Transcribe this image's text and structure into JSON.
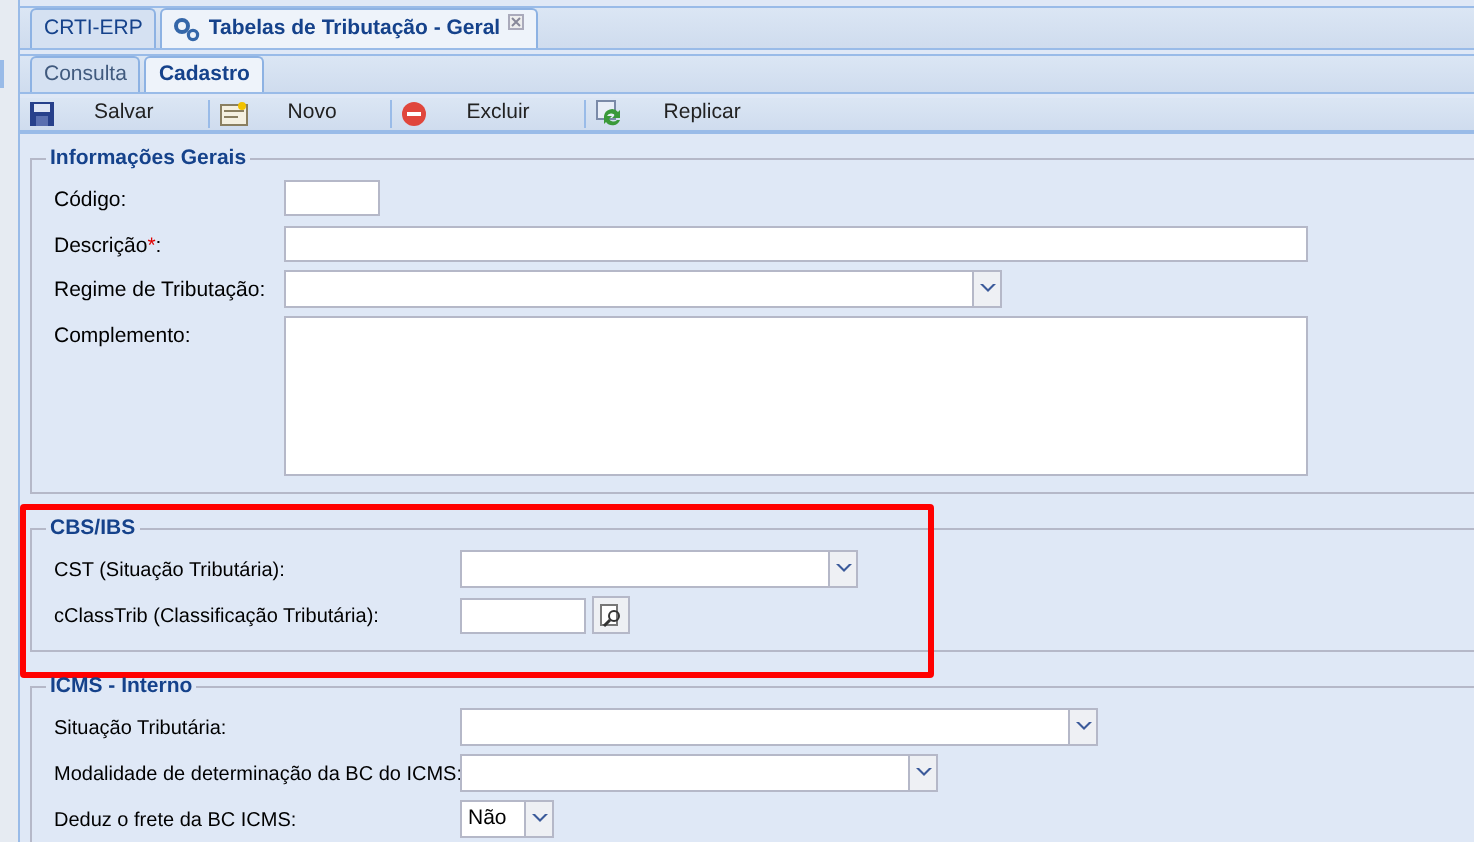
{
  "main_tabs": [
    {
      "label": "CRTI-ERP",
      "selected": false,
      "closable": false,
      "icon": false
    },
    {
      "label": "Tabelas de Tributação - Geral",
      "selected": true,
      "closable": true,
      "icon": true
    }
  ],
  "sub_tabs": [
    {
      "label": "Consulta",
      "selected": false
    },
    {
      "label": "Cadastro",
      "selected": true
    }
  ],
  "toolbar": [
    {
      "kind": "save",
      "label": "Salvar"
    },
    {
      "kind": "new",
      "label": "Novo"
    },
    {
      "kind": "delete",
      "label": "Excluir"
    },
    {
      "kind": "replicate",
      "label": "Replicar"
    }
  ],
  "sections": [
    {
      "title": "Informações Gerais",
      "highlighted": false,
      "fields": [
        {
          "label": "Código:",
          "kind": "text"
        },
        {
          "label": "Descrição",
          "required_mark": "*",
          "suffix": ":",
          "kind": "text"
        },
        {
          "label": "Regime de Tributação:",
          "kind": "combo"
        },
        {
          "label": "Complemento:",
          "kind": "textarea"
        }
      ]
    },
    {
      "title": "CBS/IBS",
      "highlighted": true,
      "fields": [
        {
          "label": "CST (Situação Tributária):",
          "kind": "combo"
        },
        {
          "label": "cClassTrib (Classificação Tributária):",
          "kind": "lookup"
        }
      ]
    },
    {
      "title": "ICMS - Interno",
      "highlighted": false,
      "fields": [
        {
          "label": "Situação Tributária:",
          "kind": "combo"
        },
        {
          "label": "Modalidade de determinação da BC do ICMS:",
          "kind": "combo"
        },
        {
          "label": "Deduz o frete da BC ICMS:",
          "kind": "combo",
          "value": "Não"
        }
      ]
    }
  ]
}
